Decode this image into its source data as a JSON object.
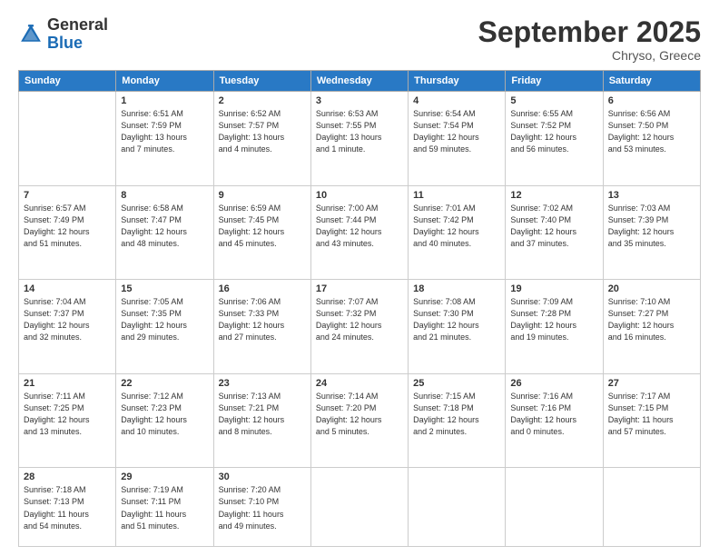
{
  "header": {
    "logo_general": "General",
    "logo_blue": "Blue",
    "month_title": "September 2025",
    "subtitle": "Chryso, Greece"
  },
  "days_of_week": [
    "Sunday",
    "Monday",
    "Tuesday",
    "Wednesday",
    "Thursday",
    "Friday",
    "Saturday"
  ],
  "weeks": [
    [
      {
        "day": "",
        "info": ""
      },
      {
        "day": "1",
        "info": "Sunrise: 6:51 AM\nSunset: 7:59 PM\nDaylight: 13 hours\nand 7 minutes."
      },
      {
        "day": "2",
        "info": "Sunrise: 6:52 AM\nSunset: 7:57 PM\nDaylight: 13 hours\nand 4 minutes."
      },
      {
        "day": "3",
        "info": "Sunrise: 6:53 AM\nSunset: 7:55 PM\nDaylight: 13 hours\nand 1 minute."
      },
      {
        "day": "4",
        "info": "Sunrise: 6:54 AM\nSunset: 7:54 PM\nDaylight: 12 hours\nand 59 minutes."
      },
      {
        "day": "5",
        "info": "Sunrise: 6:55 AM\nSunset: 7:52 PM\nDaylight: 12 hours\nand 56 minutes."
      },
      {
        "day": "6",
        "info": "Sunrise: 6:56 AM\nSunset: 7:50 PM\nDaylight: 12 hours\nand 53 minutes."
      }
    ],
    [
      {
        "day": "7",
        "info": "Sunrise: 6:57 AM\nSunset: 7:49 PM\nDaylight: 12 hours\nand 51 minutes."
      },
      {
        "day": "8",
        "info": "Sunrise: 6:58 AM\nSunset: 7:47 PM\nDaylight: 12 hours\nand 48 minutes."
      },
      {
        "day": "9",
        "info": "Sunrise: 6:59 AM\nSunset: 7:45 PM\nDaylight: 12 hours\nand 45 minutes."
      },
      {
        "day": "10",
        "info": "Sunrise: 7:00 AM\nSunset: 7:44 PM\nDaylight: 12 hours\nand 43 minutes."
      },
      {
        "day": "11",
        "info": "Sunrise: 7:01 AM\nSunset: 7:42 PM\nDaylight: 12 hours\nand 40 minutes."
      },
      {
        "day": "12",
        "info": "Sunrise: 7:02 AM\nSunset: 7:40 PM\nDaylight: 12 hours\nand 37 minutes."
      },
      {
        "day": "13",
        "info": "Sunrise: 7:03 AM\nSunset: 7:39 PM\nDaylight: 12 hours\nand 35 minutes."
      }
    ],
    [
      {
        "day": "14",
        "info": "Sunrise: 7:04 AM\nSunset: 7:37 PM\nDaylight: 12 hours\nand 32 minutes."
      },
      {
        "day": "15",
        "info": "Sunrise: 7:05 AM\nSunset: 7:35 PM\nDaylight: 12 hours\nand 29 minutes."
      },
      {
        "day": "16",
        "info": "Sunrise: 7:06 AM\nSunset: 7:33 PM\nDaylight: 12 hours\nand 27 minutes."
      },
      {
        "day": "17",
        "info": "Sunrise: 7:07 AM\nSunset: 7:32 PM\nDaylight: 12 hours\nand 24 minutes."
      },
      {
        "day": "18",
        "info": "Sunrise: 7:08 AM\nSunset: 7:30 PM\nDaylight: 12 hours\nand 21 minutes."
      },
      {
        "day": "19",
        "info": "Sunrise: 7:09 AM\nSunset: 7:28 PM\nDaylight: 12 hours\nand 19 minutes."
      },
      {
        "day": "20",
        "info": "Sunrise: 7:10 AM\nSunset: 7:27 PM\nDaylight: 12 hours\nand 16 minutes."
      }
    ],
    [
      {
        "day": "21",
        "info": "Sunrise: 7:11 AM\nSunset: 7:25 PM\nDaylight: 12 hours\nand 13 minutes."
      },
      {
        "day": "22",
        "info": "Sunrise: 7:12 AM\nSunset: 7:23 PM\nDaylight: 12 hours\nand 10 minutes."
      },
      {
        "day": "23",
        "info": "Sunrise: 7:13 AM\nSunset: 7:21 PM\nDaylight: 12 hours\nand 8 minutes."
      },
      {
        "day": "24",
        "info": "Sunrise: 7:14 AM\nSunset: 7:20 PM\nDaylight: 12 hours\nand 5 minutes."
      },
      {
        "day": "25",
        "info": "Sunrise: 7:15 AM\nSunset: 7:18 PM\nDaylight: 12 hours\nand 2 minutes."
      },
      {
        "day": "26",
        "info": "Sunrise: 7:16 AM\nSunset: 7:16 PM\nDaylight: 12 hours\nand 0 minutes."
      },
      {
        "day": "27",
        "info": "Sunrise: 7:17 AM\nSunset: 7:15 PM\nDaylight: 11 hours\nand 57 minutes."
      }
    ],
    [
      {
        "day": "28",
        "info": "Sunrise: 7:18 AM\nSunset: 7:13 PM\nDaylight: 11 hours\nand 54 minutes."
      },
      {
        "day": "29",
        "info": "Sunrise: 7:19 AM\nSunset: 7:11 PM\nDaylight: 11 hours\nand 51 minutes."
      },
      {
        "day": "30",
        "info": "Sunrise: 7:20 AM\nSunset: 7:10 PM\nDaylight: 11 hours\nand 49 minutes."
      },
      {
        "day": "",
        "info": ""
      },
      {
        "day": "",
        "info": ""
      },
      {
        "day": "",
        "info": ""
      },
      {
        "day": "",
        "info": ""
      }
    ]
  ]
}
